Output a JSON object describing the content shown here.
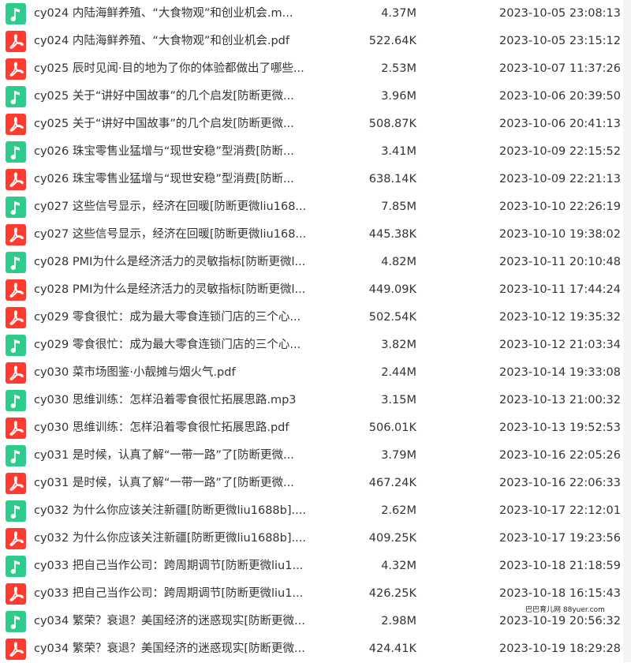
{
  "colors": {
    "audio": "#2ecc8a",
    "pdf": "#ff3b30"
  },
  "icons": {
    "audio": "music-note-icon",
    "pdf": "pdf-icon"
  },
  "files": [
    {
      "type": "audio",
      "name": "cy024 内陆海鲜养殖、“大食物观”和创业机会.m...",
      "size": "4.37M",
      "date": "2023-10-05 23:08:13"
    },
    {
      "type": "pdf",
      "name": "cy024 内陆海鲜养殖、“大食物观”和创业机会.pdf",
      "size": "522.64K",
      "date": "2023-10-05 23:15:12"
    },
    {
      "type": "pdf",
      "name": "cy025 辰时见闻·目的地为了你的体验都做出了哪些...",
      "size": "2.53M",
      "date": "2023-10-07 11:37:26"
    },
    {
      "type": "audio",
      "name": "cy025 关于“讲好中国故事”的几个启发[防断更微...",
      "size": "3.96M",
      "date": "2023-10-06 20:39:50"
    },
    {
      "type": "pdf",
      "name": "cy025 关于“讲好中国故事”的几个启发[防断更微...",
      "size": "508.87K",
      "date": "2023-10-06 20:41:13"
    },
    {
      "type": "audio",
      "name": "cy026 珠宝零售业猛增与“现世安稳”型消费[防断...",
      "size": "3.41M",
      "date": "2023-10-09 22:15:52"
    },
    {
      "type": "pdf",
      "name": "cy026 珠宝零售业猛增与“现世安稳”型消费[防断...",
      "size": "638.14K",
      "date": "2023-10-09 22:21:13"
    },
    {
      "type": "audio",
      "name": "cy027 这些信号显示，经济在回暖[防断更微liu168...",
      "size": "7.85M",
      "date": "2023-10-10 22:26:19"
    },
    {
      "type": "pdf",
      "name": "cy027 这些信号显示，经济在回暖[防断更微liu168...",
      "size": "445.38K",
      "date": "2023-10-10 19:38:02"
    },
    {
      "type": "audio",
      "name": "cy028 PMI为什么是经济活力的灵敏指标[防断更微l...",
      "size": "4.82M",
      "date": "2023-10-11 20:10:48"
    },
    {
      "type": "pdf",
      "name": "cy028 PMI为什么是经济活力的灵敏指标[防断更微l...",
      "size": "449.09K",
      "date": "2023-10-11 17:44:24"
    },
    {
      "type": "pdf",
      "name": "cy029 零食很忙：成为最大零食连锁门店的三个心...",
      "size": "502.54K",
      "date": "2023-10-12 19:35:32"
    },
    {
      "type": "audio",
      "name": "cy029 零食很忙：成为最大零食连锁门店的三个心...",
      "size": "3.82M",
      "date": "2023-10-12 21:03:34"
    },
    {
      "type": "pdf",
      "name": "cy030 菜市场图鉴·小靓摊与烟火气.pdf",
      "size": "2.44M",
      "date": "2023-10-14 19:33:08"
    },
    {
      "type": "audio",
      "name": "cy030 思维训练：怎样沿着零食很忙拓展思路.mp3",
      "size": "3.15M",
      "date": "2023-10-13 21:00:32"
    },
    {
      "type": "pdf",
      "name": "cy030 思维训练：怎样沿着零食很忙拓展思路.pdf",
      "size": "506.01K",
      "date": "2023-10-13 19:52:53"
    },
    {
      "type": "audio",
      "name": "cy031 是时候，认真了解“一带一路”了[防断更微...",
      "size": "3.79M",
      "date": "2023-10-16 22:05:26"
    },
    {
      "type": "pdf",
      "name": "cy031 是时候，认真了解“一带一路”了[防断更微...",
      "size": "467.24K",
      "date": "2023-10-16 22:06:33"
    },
    {
      "type": "audio",
      "name": "cy032 为什么你应该关注新疆[防断更微liu1688b]....",
      "size": "2.62M",
      "date": "2023-10-17 22:12:01"
    },
    {
      "type": "pdf",
      "name": "cy032 为什么你应该关注新疆[防断更微liu1688b]....",
      "size": "409.25K",
      "date": "2023-10-17 19:23:56"
    },
    {
      "type": "audio",
      "name": "cy033 把自己当作公司：跨周期调节[防断更微liu1...",
      "size": "4.32M",
      "date": "2023-10-18 21:18:59"
    },
    {
      "type": "pdf",
      "name": "cy033 把自己当作公司：跨周期调节[防断更微liu1...",
      "size": "426.25K",
      "date": "2023-10-18 16:15:43"
    },
    {
      "type": "audio",
      "name": "cy034 繁荣？衰退？美国经济的迷惑现实[防断更微...",
      "size": "2.98M",
      "date": "2023-10-19 20:56:32"
    },
    {
      "type": "pdf",
      "name": "cy034 繁荣？衰退？美国经济的迷惑现实[防断更微...",
      "size": "424.41K",
      "date": "2023-10-19 18:29:28"
    }
  ],
  "watermark": "巴巴育儿网 88yuer.com"
}
